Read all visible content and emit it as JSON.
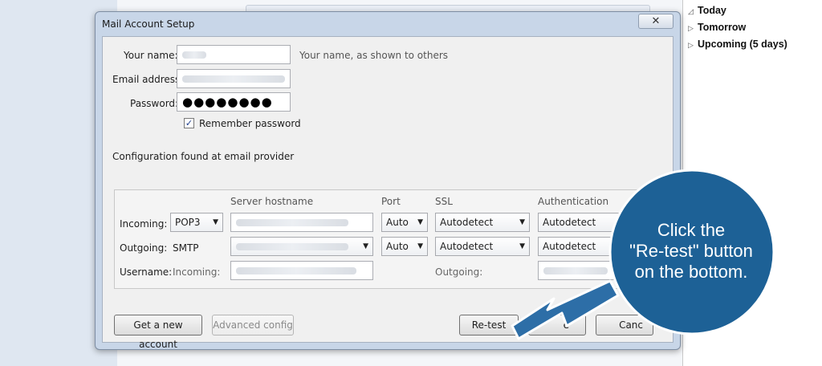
{
  "agenda": {
    "today": "Today",
    "tomorrow": "Tomorrow",
    "upcoming": "Upcoming (5 days)"
  },
  "dialog": {
    "title": "Mail Account Setup",
    "close_glyph": "✕",
    "name_label": "Your name:",
    "name_hint": "Your name, as shown to others",
    "email_label": "Email address:",
    "password_label": "Password:",
    "password_value": "●●●●●●●●",
    "remember_label": "Remember password",
    "remember_checked": "✓",
    "config_status": "Configuration found at email provider"
  },
  "server_config": {
    "headers": {
      "hostname": "Server hostname",
      "port": "Port",
      "ssl": "SSL",
      "auth": "Authentication"
    },
    "incoming": {
      "label": "Incoming:",
      "protocol": "POP3",
      "port": "Auto",
      "ssl": "Autodetect",
      "auth": "Autodetect"
    },
    "outgoing": {
      "label": "Outgoing:",
      "protocol": "SMTP",
      "port": "Auto",
      "ssl": "Autodetect",
      "auth": "Autodetect"
    },
    "username": {
      "label": "Username:",
      "incoming_label": "Incoming:",
      "outgoing_label": "Outgoing:"
    }
  },
  "buttons": {
    "get_new_account": "Get a new account",
    "advanced_config": "Advanced config",
    "retest": "Re-test",
    "done_partial": "e",
    "cancel_partial": "Canc"
  },
  "callout": {
    "line1": "Click the",
    "line2": "\"Re-test\" button",
    "line3": "on the bottom.",
    "color": "#1d6196"
  }
}
